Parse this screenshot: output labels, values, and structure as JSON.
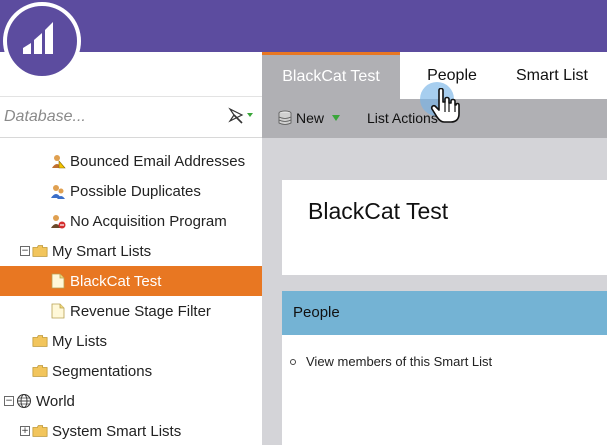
{
  "search": {
    "placeholder": "Database..."
  },
  "tabs": [
    {
      "label": "BlackCat Test",
      "active": true
    },
    {
      "label": "People",
      "active": false
    },
    {
      "label": "Smart List",
      "active": false
    }
  ],
  "toolbar": {
    "new_label": "New",
    "list_actions_label": "List Actions"
  },
  "tree": [
    {
      "label": "Bounced Email Addresses",
      "icon": "warning-person-icon"
    },
    {
      "label": "Possible Duplicates",
      "icon": "duplicate-people-icon"
    },
    {
      "label": "No Acquisition Program",
      "icon": "no-acquisition-icon"
    },
    {
      "label": "My Smart Lists",
      "icon": "folder-icon",
      "toggle": "−"
    },
    {
      "label": "BlackCat Test",
      "icon": "smart-list-icon",
      "selected": true
    },
    {
      "label": "Revenue Stage Filter",
      "icon": "smart-list-icon"
    },
    {
      "label": "My Lists",
      "icon": "folder-icon"
    },
    {
      "label": "Segmentations",
      "icon": "folder-icon"
    },
    {
      "label": "World",
      "icon": "globe-icon",
      "toggle": "−"
    },
    {
      "label": "System Smart Lists",
      "icon": "folder-icon",
      "toggle": "+"
    }
  ],
  "main": {
    "title": "BlackCat Test",
    "section_title": "People",
    "links": [
      "View members of this Smart List"
    ]
  },
  "colors": {
    "brand": "#5c4c9f",
    "accent": "#e87722",
    "section": "#74b3d4",
    "panel": "#b0b0b4"
  }
}
